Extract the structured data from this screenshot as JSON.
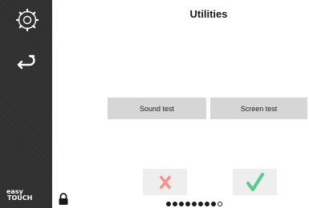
{
  "header": {
    "title": "Utilities"
  },
  "sidebar": {
    "icons": [
      "gear-icon",
      "back-arrow-icon"
    ],
    "brand": {
      "line1": "easy",
      "line2": "TOUCH"
    }
  },
  "status": {
    "lock_icon": "lock-icon"
  },
  "main": {
    "buttons": {
      "sound_test": "Sound test",
      "screen_test": "Screen test"
    }
  },
  "actions": {
    "cancel_icon": "cross-icon",
    "confirm_icon": "check-icon",
    "colors": {
      "cancel": "#f0948c",
      "confirm": "#5cc98d"
    }
  },
  "pagination": {
    "total": 9,
    "current": 9
  }
}
